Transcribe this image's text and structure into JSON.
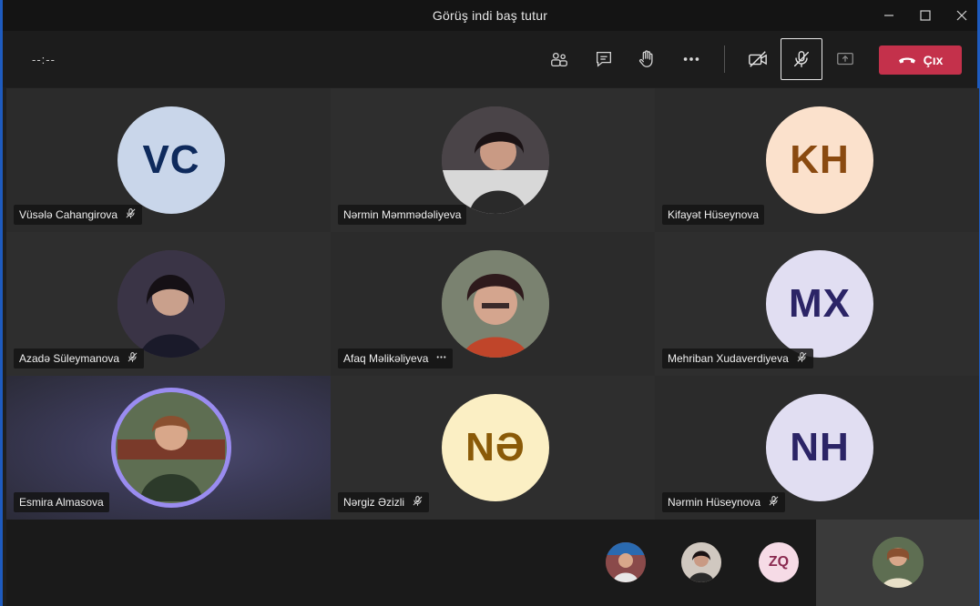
{
  "window": {
    "title": "Görüş indi baş tutur"
  },
  "toolbar": {
    "timer": "--:--",
    "leave_label": "Çıx"
  },
  "colors": {
    "leave": "#c4314b",
    "active_ring": "#9a8cf0",
    "mic_off_outline": "#e8e8e8"
  },
  "participants": [
    {
      "name": "Vüsələ Cahangirova",
      "initials": "VC",
      "avatar_bg": "#c9d6ea",
      "avatar_fg": "#0e2a5c",
      "status_icon": "mic-off-icon"
    },
    {
      "name": "Nərmin Məmmədəliyeva",
      "initials": "",
      "avatar_bg": "#5c5458",
      "avatar_fg": "#ffffff",
      "status_icon": ""
    },
    {
      "name": "Kifayət Hüseynova",
      "initials": "KH",
      "avatar_bg": "#fbe1cc",
      "avatar_fg": "#8a4a10",
      "status_icon": ""
    },
    {
      "name": "Azadə Süleymanova",
      "initials": "",
      "avatar_bg": "#4a3c4e",
      "avatar_fg": "#ffffff",
      "status_icon": "mic-off-icon"
    },
    {
      "name": "Afaq Məlikəliyeva",
      "initials": "",
      "avatar_bg": "#7b6e66",
      "avatar_fg": "#ffffff",
      "status_icon": "more-icon"
    },
    {
      "name": "Mehriban Xudaverdiyeva",
      "initials": "MX",
      "avatar_bg": "#e1def2",
      "avatar_fg": "#2b2466",
      "status_icon": "mic-off-icon"
    },
    {
      "name": "Esmira Almasova",
      "initials": "",
      "avatar_bg": "#5e6e52",
      "avatar_fg": "#ffffff",
      "status_icon": ""
    },
    {
      "name": "Nərgiz Əzizli",
      "initials": "NƏ",
      "avatar_bg": "#fbefc4",
      "avatar_fg": "#8a5a08",
      "status_icon": "mic-off-icon"
    },
    {
      "name": "Nərmin Hüseynova",
      "initials": "NH",
      "avatar_bg": "#e1def2",
      "avatar_fg": "#2b2466",
      "status_icon": "mic-off-icon"
    }
  ],
  "overflow": [
    {
      "initials": "",
      "avatar_bg": "#8a4a4a"
    },
    {
      "initials": "",
      "avatar_bg": "#6a5a50"
    },
    {
      "initials": "ZQ",
      "avatar_bg": "#f6dbe6",
      "avatar_fg": "#8a2a50"
    }
  ]
}
